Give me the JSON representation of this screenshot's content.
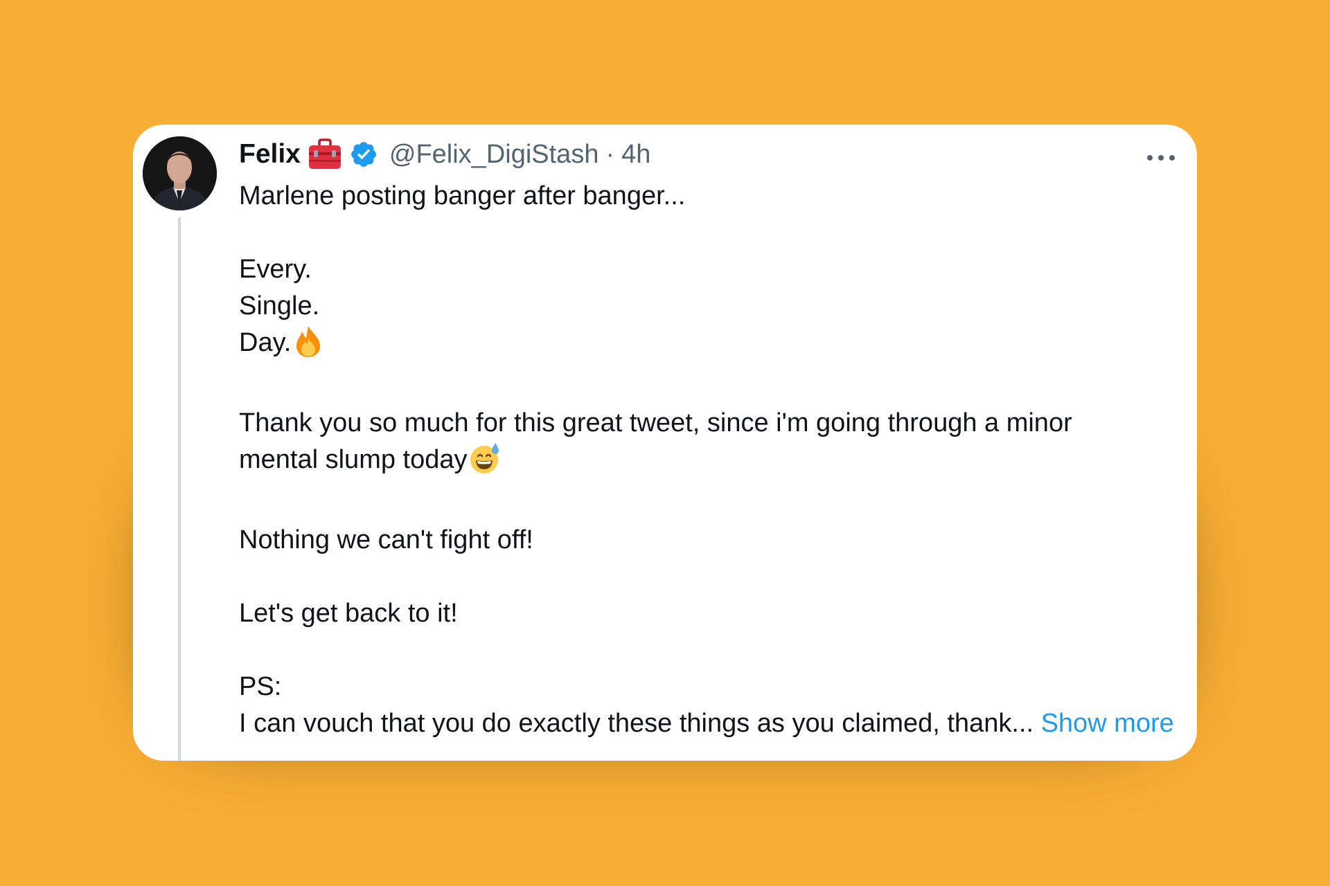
{
  "tweet": {
    "author": {
      "name": "Felix",
      "handle": "@Felix_DigiStash",
      "badge_icon": "toolbox-icon",
      "verified_icon": "verified-badge-icon",
      "avatar_icon": "user-avatar"
    },
    "separator": "·",
    "time": "4h",
    "more_icon": "more-options-icon",
    "text": {
      "line1": "Marlene posting banger after banger...",
      "line2": "Every.",
      "line3": "Single.",
      "line4": "Day.",
      "line4_emoji": "fire-emoji",
      "line5a": "Thank you so much for this great tweet, since i'm going through a minor",
      "line5b": "mental slump today",
      "line5b_emoji": "grinning-face-with-sweat-emoji",
      "line6": "Nothing we can't fight off!",
      "line7": "Let's get back to it!",
      "line8": "PS:",
      "line9": "I can vouch that you do exactly these things as you claimed, thank...",
      "show_more": "Show more"
    }
  },
  "colors": {
    "background": "#f8ae34",
    "card": "#ffffff",
    "text": "#0f1419",
    "secondary_text": "#536471",
    "link": "#1d9bf0",
    "verified": "#1d9bf0",
    "thread_line": "#cfd9de"
  }
}
